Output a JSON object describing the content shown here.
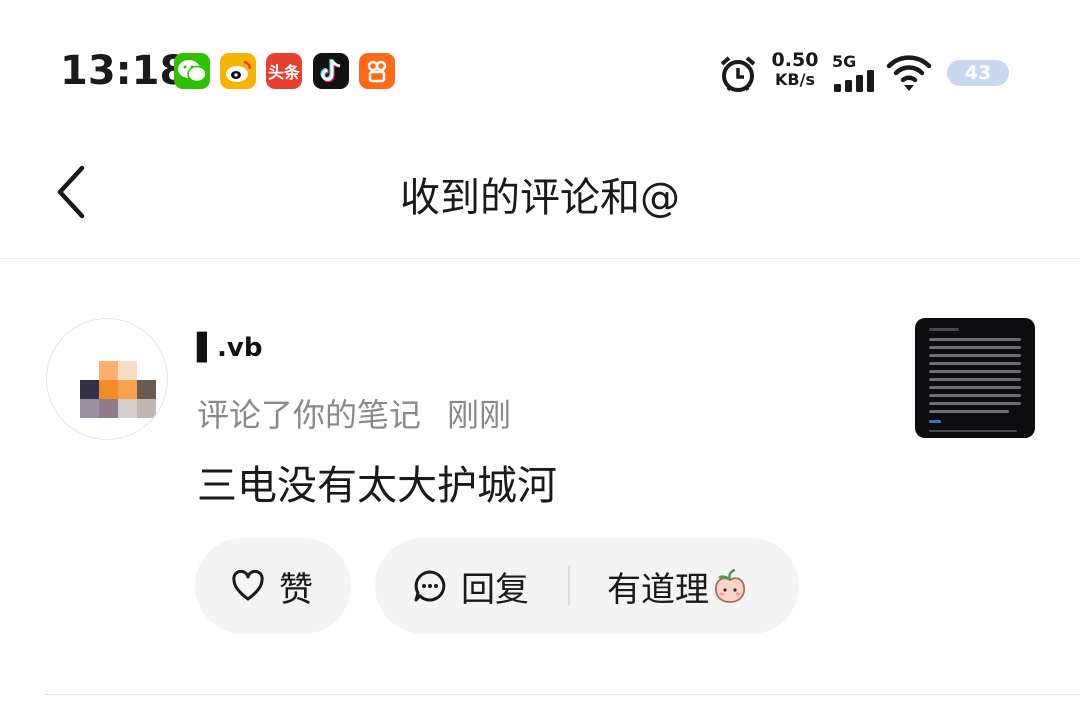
{
  "status_bar": {
    "time": "13:18",
    "app_icons": [
      "wechat-icon",
      "weibo-icon",
      "toutiao-icon",
      "douyin-icon",
      "kuaishou-icon"
    ],
    "toutiao_label": "头条",
    "net_speed_value": "0.50",
    "net_speed_unit": "KB/s",
    "network": "5G",
    "battery": "43",
    "colors": {
      "wechat": "#2dc100",
      "weibo": "#f5b400",
      "toutiao": "#e8402f",
      "douyin": "#111111",
      "kuaishou": "#ff6a18",
      "battery": "#c8d8f0"
    }
  },
  "header": {
    "title": "收到的评论和@"
  },
  "notification": {
    "username": "▌.vb",
    "action": "评论了你的笔记",
    "time": "刚刚",
    "comment": "三电没有太大护城河",
    "actions": {
      "like_label": "赞",
      "reply_label": "回复",
      "quick_reply_label": "有道理"
    }
  }
}
